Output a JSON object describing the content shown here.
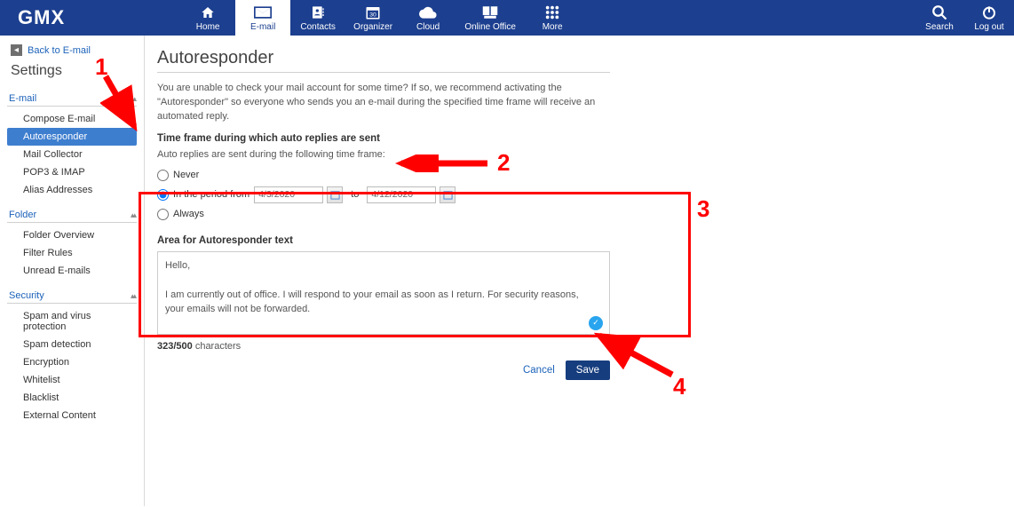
{
  "brand": "GMX",
  "nav": {
    "home": "Home",
    "email": "E-mail",
    "contacts": "Contacts",
    "organizer": "Organizer",
    "cloud": "Cloud",
    "online_office": "Online Office",
    "more": "More",
    "search": "Search",
    "logout": "Log out"
  },
  "sidebar": {
    "back": "Back to E-mail",
    "title": "Settings",
    "sections": {
      "email": {
        "label": "E-mail",
        "items": [
          "Compose E-mail",
          "Autoresponder",
          "Mail Collector",
          "POP3 & IMAP",
          "Alias Addresses"
        ]
      },
      "folder": {
        "label": "Folder",
        "items": [
          "Folder Overview",
          "Filter Rules",
          "Unread E-mails"
        ]
      },
      "security": {
        "label": "Security",
        "items": [
          "Spam and virus protection",
          "Spam detection",
          "Encryption",
          "Whitelist",
          "Blacklist",
          "External Content"
        ]
      }
    }
  },
  "main": {
    "heading": "Autoresponder",
    "description": "You are unable to check your mail account for some time? If so, we recommend activating the \"Autoresponder\" so everyone who sends you an e-mail during the specified time frame will receive an automated reply.",
    "timeframe_head": "Time frame during which auto replies are sent",
    "timeframe_desc": "Auto replies are sent during the following time frame:",
    "radio_never": "Never",
    "radio_period_prefix": "In the period from",
    "radio_period_to": "to",
    "radio_always": "Always",
    "date_from": "4/3/2020",
    "date_to": "4/12/2020",
    "textarea_head": "Area for Autoresponder text",
    "textarea_value": "Hello,\n\nI am currently out of office. I will respond to your email as soon as I return. For security reasons, your emails will not be forwarded.\n\nBest Wishes,\n\nJohn Smith",
    "counter_count": "323/500",
    "counter_label": " characters",
    "cancel": "Cancel",
    "save": "Save"
  },
  "annotations": {
    "n1": "1",
    "n2": "2",
    "n3": "3",
    "n4": "4"
  }
}
